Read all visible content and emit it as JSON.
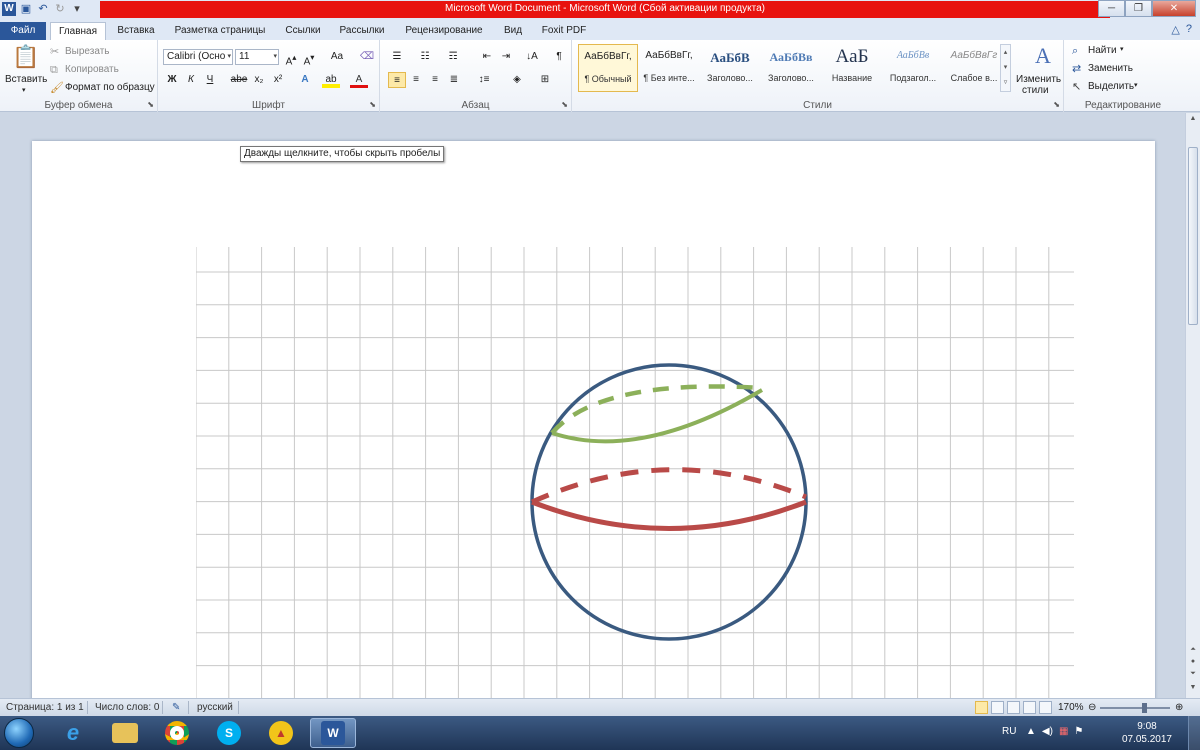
{
  "window": {
    "title": "Microsoft Word Document  -  Microsoft Word (Сбой активации продукта)",
    "accent": "#e8130f"
  },
  "tabs": [
    {
      "label": "Файл"
    },
    {
      "label": "Главная"
    },
    {
      "label": "Вставка"
    },
    {
      "label": "Разметка страницы"
    },
    {
      "label": "Ссылки"
    },
    {
      "label": "Рассылки"
    },
    {
      "label": "Рецензирование"
    },
    {
      "label": "Вид"
    },
    {
      "label": "Foxit PDF"
    }
  ],
  "clipboard": {
    "paste": "Вставить",
    "cut": "Вырезать",
    "copy": "Копировать",
    "format_painter": "Формат по образцу",
    "group": "Буфер обмена"
  },
  "font": {
    "name": "Calibri (Осно",
    "size": "11",
    "group": "Шрифт",
    "bold": "Ж",
    "italic": "К",
    "underline": "Ч",
    "strike": "abe",
    "sub": "x₂",
    "sup": "x²",
    "case": "Aa"
  },
  "paragraph": {
    "group": "Абзац"
  },
  "styles": {
    "group": "Стили",
    "items": [
      {
        "sample": "АаБбВвГг,",
        "name": "¶ Обычный"
      },
      {
        "sample": "АаБбВвГг,",
        "name": "¶ Без инте..."
      },
      {
        "sample": "АаБбВ",
        "name": "Заголово..."
      },
      {
        "sample": "АаБбВв",
        "name": "Заголово..."
      },
      {
        "sample": "AaБ",
        "name": "Название"
      },
      {
        "sample": "АаБбВв",
        "name": "Подзагол..."
      },
      {
        "sample": "АаБбВвГг",
        "name": "Слабое в..."
      }
    ],
    "change": "Изменить",
    "change2": "стили"
  },
  "editing": {
    "group": "Редактирование",
    "find": "Найти",
    "replace": "Заменить",
    "select": "Выделить"
  },
  "tooltip": "Дважды щелкните, чтобы скрыть пробелы",
  "status": {
    "page": "Страница: 1 из 1",
    "words": "Число слов: 0",
    "lang": "русский",
    "zoom": "170%"
  },
  "tray": {
    "lang": "RU",
    "time": "9:08",
    "date": "07.05.2017"
  },
  "drawing": {
    "circle_color": "#3a5a80",
    "equator_color": "#b94a48",
    "small_circle_color": "#8cb05a",
    "grid_color": "#c8c8c8"
  }
}
